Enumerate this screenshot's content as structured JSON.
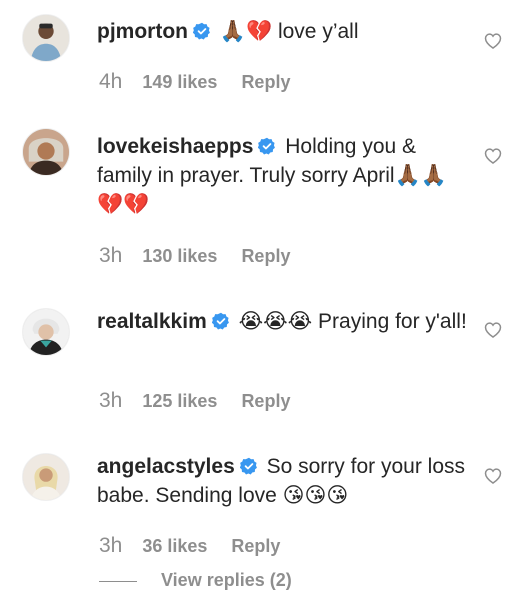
{
  "comments": [
    {
      "username": "pjmorton",
      "text": "🙏🏾💔 love y’all",
      "time": "4h",
      "likes": "149 likes",
      "reply": "Reply"
    },
    {
      "username": "lovekeishaepps",
      "text": "Holding you & family in prayer. Truly sorry April🙏🏾🙏🏾💔💔",
      "time": "3h",
      "likes": "130 likes",
      "reply": "Reply"
    },
    {
      "username": "realtalkkim",
      "text": "😭😭😭 Praying for y'all!",
      "time": "3h",
      "likes": "125 likes",
      "reply": "Reply"
    },
    {
      "username": "angelacstyles",
      "text": "So sorry for your loss babe. Sending love 😘😘😘",
      "time": "3h",
      "likes": "36 likes",
      "reply": "Reply"
    }
  ],
  "view_replies": "View replies (2)",
  "icons": {
    "verified": "verified-badge-icon",
    "like": "heart-outline-icon"
  },
  "colors": {
    "verified_blue": "#3897f0",
    "meta_gray": "#8e8e8e",
    "text": "#262626"
  }
}
